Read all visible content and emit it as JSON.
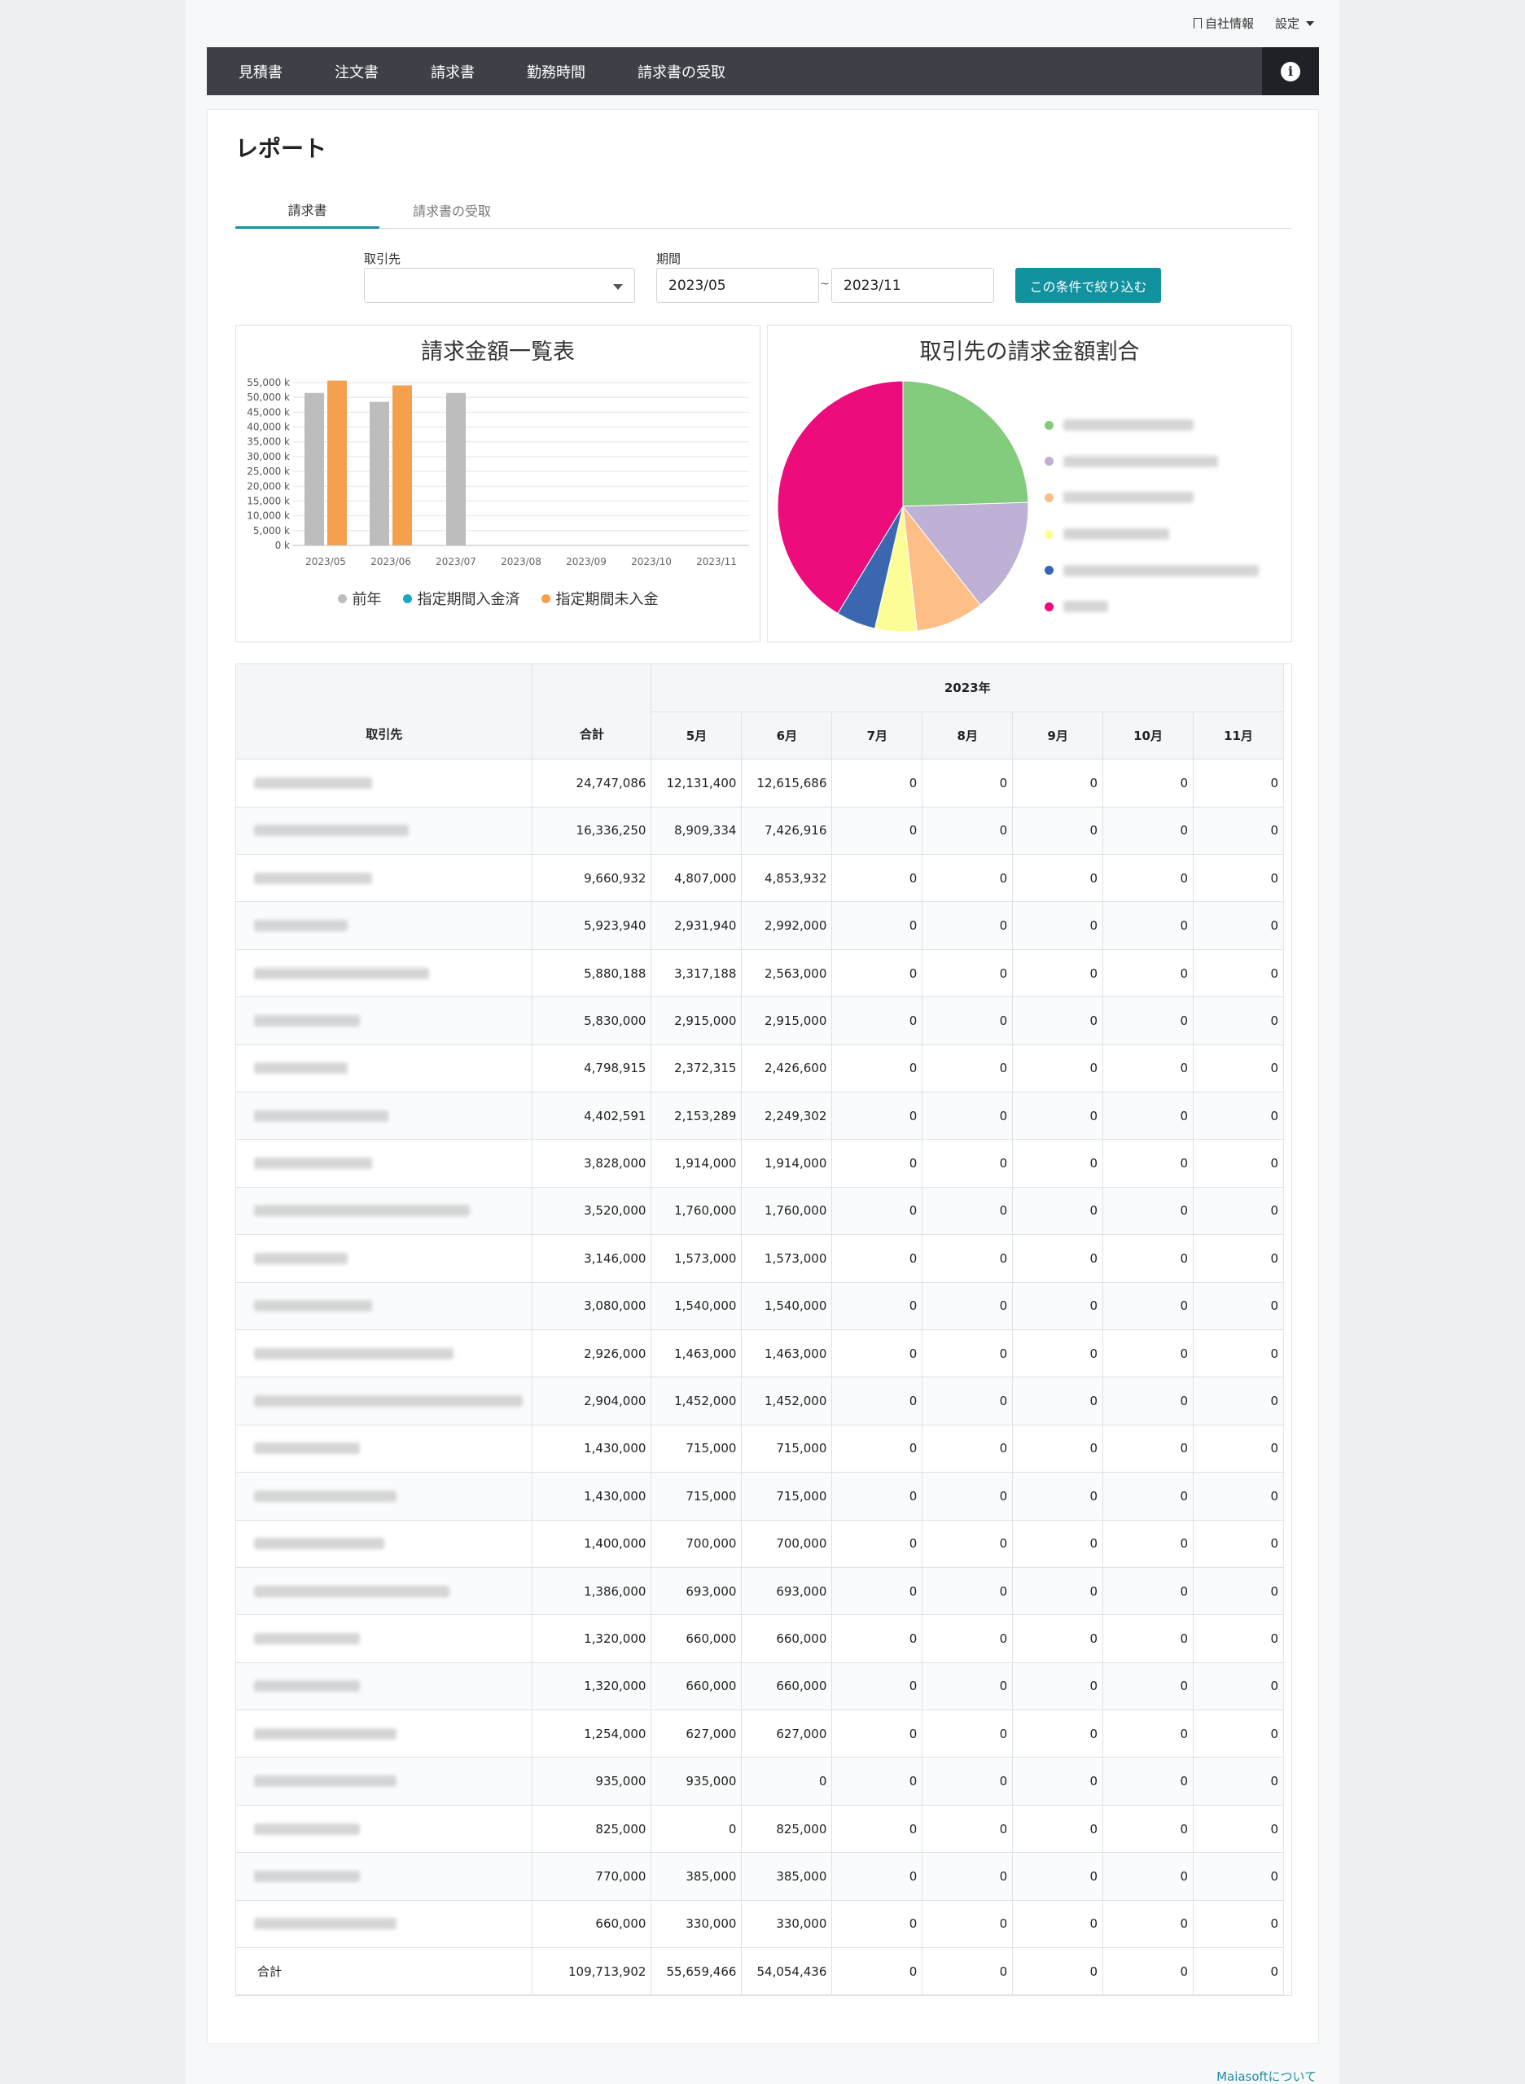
{
  "topbar": {
    "company_info": "自社情報",
    "settings": "設定"
  },
  "nav": {
    "items": [
      "見積書",
      "注文書",
      "請求書",
      "勤務時間",
      "請求書の受取"
    ]
  },
  "page": {
    "title": "レポート"
  },
  "tabs": [
    {
      "label": "請求書",
      "active": true
    },
    {
      "label": "請求書の受取",
      "active": false
    }
  ],
  "filters": {
    "client_label": "取引先",
    "client_value": "",
    "period_label": "期間",
    "period_from": "2023/05",
    "period_sep": "~",
    "period_to": "2023/11",
    "submit_label": "この条件で絞り込む"
  },
  "bar_panel": {
    "title": "請求金額一覧表"
  },
  "pie_panel": {
    "title": "取引先の請求金額割合"
  },
  "chart_data": [
    {
      "type": "bar",
      "title": "請求金額一覧表",
      "categories": [
        "2023/05",
        "2023/06",
        "2023/07",
        "2023/08",
        "2023/09",
        "2023/10",
        "2023/11"
      ],
      "y_ticks": [
        "55,000 k",
        "50,000 k",
        "45,000 k",
        "40,000 k",
        "35,000 k",
        "30,000 k",
        "25,000 k",
        "20,000 k",
        "15,000 k",
        "10,000 k",
        "5,000 k",
        "0 k"
      ],
      "ylim": [
        0,
        55000
      ],
      "y_unit": "k",
      "series": [
        {
          "name": "前年",
          "color": "#bdbdbd",
          "values": [
            51500,
            48500,
            51500,
            0,
            0,
            0,
            0
          ]
        },
        {
          "name": "指定期間入金済",
          "color": "#1aa6c7",
          "values": [
            0,
            0,
            0,
            0,
            0,
            0,
            0
          ]
        },
        {
          "name": "指定期間未入金",
          "color": "#f4a04c",
          "values": [
            55659,
            54054,
            0,
            0,
            0,
            0,
            0
          ]
        }
      ],
      "legend_position": "bottom",
      "grid": true
    },
    {
      "type": "pie",
      "title": "取引先の請求金額割合",
      "slices": [
        {
          "label": "",
          "value": 24.5,
          "color": "#83cb7d"
        },
        {
          "label": "",
          "value": 14.9,
          "color": "#bfb0d6"
        },
        {
          "label": "",
          "value": 8.8,
          "color": "#fdbf85"
        },
        {
          "label": "",
          "value": 5.4,
          "color": "#fdfd98"
        },
        {
          "label": "",
          "value": 5.1,
          "color": "#3a67b0"
        },
        {
          "label": "",
          "value": 41.3,
          "color": "#ec0c7c"
        }
      ],
      "legend_position": "right"
    }
  ],
  "table": {
    "col_client": "取引先",
    "col_total": "合計",
    "year_header": "2023年",
    "months": [
      "5月",
      "6月",
      "7月",
      "8月",
      "9月",
      "10月",
      "11月"
    ],
    "rows": [
      {
        "total": "24,747,086",
        "m": [
          "12,131,400",
          "12,615,686",
          "0",
          "0",
          "0",
          "0",
          "0"
        ]
      },
      {
        "total": "16,336,250",
        "m": [
          "8,909,334",
          "7,426,916",
          "0",
          "0",
          "0",
          "0",
          "0"
        ]
      },
      {
        "total": "9,660,932",
        "m": [
          "4,807,000",
          "4,853,932",
          "0",
          "0",
          "0",
          "0",
          "0"
        ]
      },
      {
        "total": "5,923,940",
        "m": [
          "2,931,940",
          "2,992,000",
          "0",
          "0",
          "0",
          "0",
          "0"
        ]
      },
      {
        "total": "5,880,188",
        "m": [
          "3,317,188",
          "2,563,000",
          "0",
          "0",
          "0",
          "0",
          "0"
        ]
      },
      {
        "total": "5,830,000",
        "m": [
          "2,915,000",
          "2,915,000",
          "0",
          "0",
          "0",
          "0",
          "0"
        ]
      },
      {
        "total": "4,798,915",
        "m": [
          "2,372,315",
          "2,426,600",
          "0",
          "0",
          "0",
          "0",
          "0"
        ]
      },
      {
        "total": "4,402,591",
        "m": [
          "2,153,289",
          "2,249,302",
          "0",
          "0",
          "0",
          "0",
          "0"
        ]
      },
      {
        "total": "3,828,000",
        "m": [
          "1,914,000",
          "1,914,000",
          "0",
          "0",
          "0",
          "0",
          "0"
        ]
      },
      {
        "total": "3,520,000",
        "m": [
          "1,760,000",
          "1,760,000",
          "0",
          "0",
          "0",
          "0",
          "0"
        ]
      },
      {
        "total": "3,146,000",
        "m": [
          "1,573,000",
          "1,573,000",
          "0",
          "0",
          "0",
          "0",
          "0"
        ]
      },
      {
        "total": "3,080,000",
        "m": [
          "1,540,000",
          "1,540,000",
          "0",
          "0",
          "0",
          "0",
          "0"
        ]
      },
      {
        "total": "2,926,000",
        "m": [
          "1,463,000",
          "1,463,000",
          "0",
          "0",
          "0",
          "0",
          "0"
        ]
      },
      {
        "total": "2,904,000",
        "m": [
          "1,452,000",
          "1,452,000",
          "0",
          "0",
          "0",
          "0",
          "0"
        ]
      },
      {
        "total": "1,430,000",
        "m": [
          "715,000",
          "715,000",
          "0",
          "0",
          "0",
          "0",
          "0"
        ]
      },
      {
        "total": "1,430,000",
        "m": [
          "715,000",
          "715,000",
          "0",
          "0",
          "0",
          "0",
          "0"
        ]
      },
      {
        "total": "1,400,000",
        "m": [
          "700,000",
          "700,000",
          "0",
          "0",
          "0",
          "0",
          "0"
        ]
      },
      {
        "total": "1,386,000",
        "m": [
          "693,000",
          "693,000",
          "0",
          "0",
          "0",
          "0",
          "0"
        ]
      },
      {
        "total": "1,320,000",
        "m": [
          "660,000",
          "660,000",
          "0",
          "0",
          "0",
          "0",
          "0"
        ]
      },
      {
        "total": "1,320,000",
        "m": [
          "660,000",
          "660,000",
          "0",
          "0",
          "0",
          "0",
          "0"
        ]
      },
      {
        "total": "1,254,000",
        "m": [
          "627,000",
          "627,000",
          "0",
          "0",
          "0",
          "0",
          "0"
        ]
      },
      {
        "total": "935,000",
        "m": [
          "935,000",
          "0",
          "0",
          "0",
          "0",
          "0",
          "0"
        ]
      },
      {
        "total": "825,000",
        "m": [
          "0",
          "825,000",
          "0",
          "0",
          "0",
          "0",
          "0"
        ]
      },
      {
        "total": "770,000",
        "m": [
          "385,000",
          "385,000",
          "0",
          "0",
          "0",
          "0",
          "0"
        ]
      },
      {
        "total": "660,000",
        "m": [
          "330,000",
          "330,000",
          "0",
          "0",
          "0",
          "0",
          "0"
        ]
      }
    ],
    "footer": {
      "label": "合計",
      "total": "109,713,902",
      "m": [
        "55,659,466",
        "54,054,436",
        "0",
        "0",
        "0",
        "0",
        "0"
      ]
    }
  },
  "footer": {
    "about_link": "Maiasoftについて"
  },
  "colors": {
    "accent": "#12919f",
    "nav_bg": "#3d4047",
    "nav_dark": "#1e2227"
  }
}
